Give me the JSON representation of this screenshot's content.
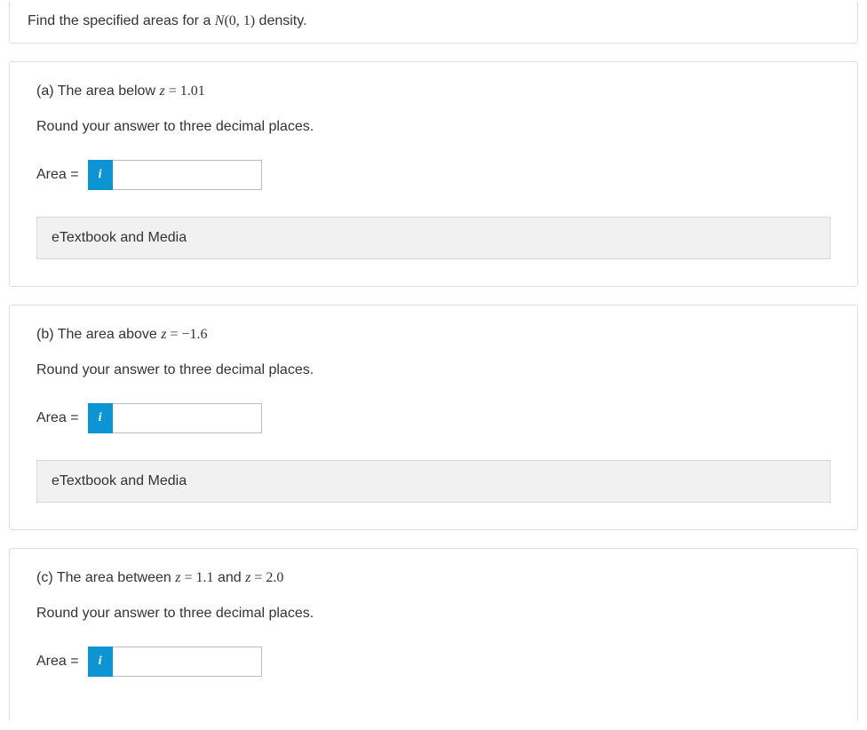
{
  "intro": {
    "prefix": "Find the specified areas for a ",
    "math_N": "N",
    "math_args": "(0, 1)",
    "suffix": " density."
  },
  "questions": {
    "a": {
      "label_prefix": "(a) The area below ",
      "z_var": "z",
      "eq": " = ",
      "z_val": "1.01",
      "instruction": "Round your answer to three decimal places.",
      "answer_label": "Area = ",
      "media_label": "eTextbook and Media"
    },
    "b": {
      "label_prefix": "(b) The area above ",
      "z_var": "z",
      "eq": " = ",
      "z_val": "−1.6",
      "instruction": "Round your answer to three decimal places.",
      "answer_label": "Area = ",
      "media_label": "eTextbook and Media"
    },
    "c": {
      "label_prefix": "(c) The area between ",
      "z_var": "z",
      "eq": " = ",
      "z_val1": "1.1",
      "mid": " and ",
      "z_val2": "2.0",
      "instruction": "Round your answer to three decimal places.",
      "answer_label": "Area = "
    }
  },
  "icons": {
    "info": "i"
  }
}
